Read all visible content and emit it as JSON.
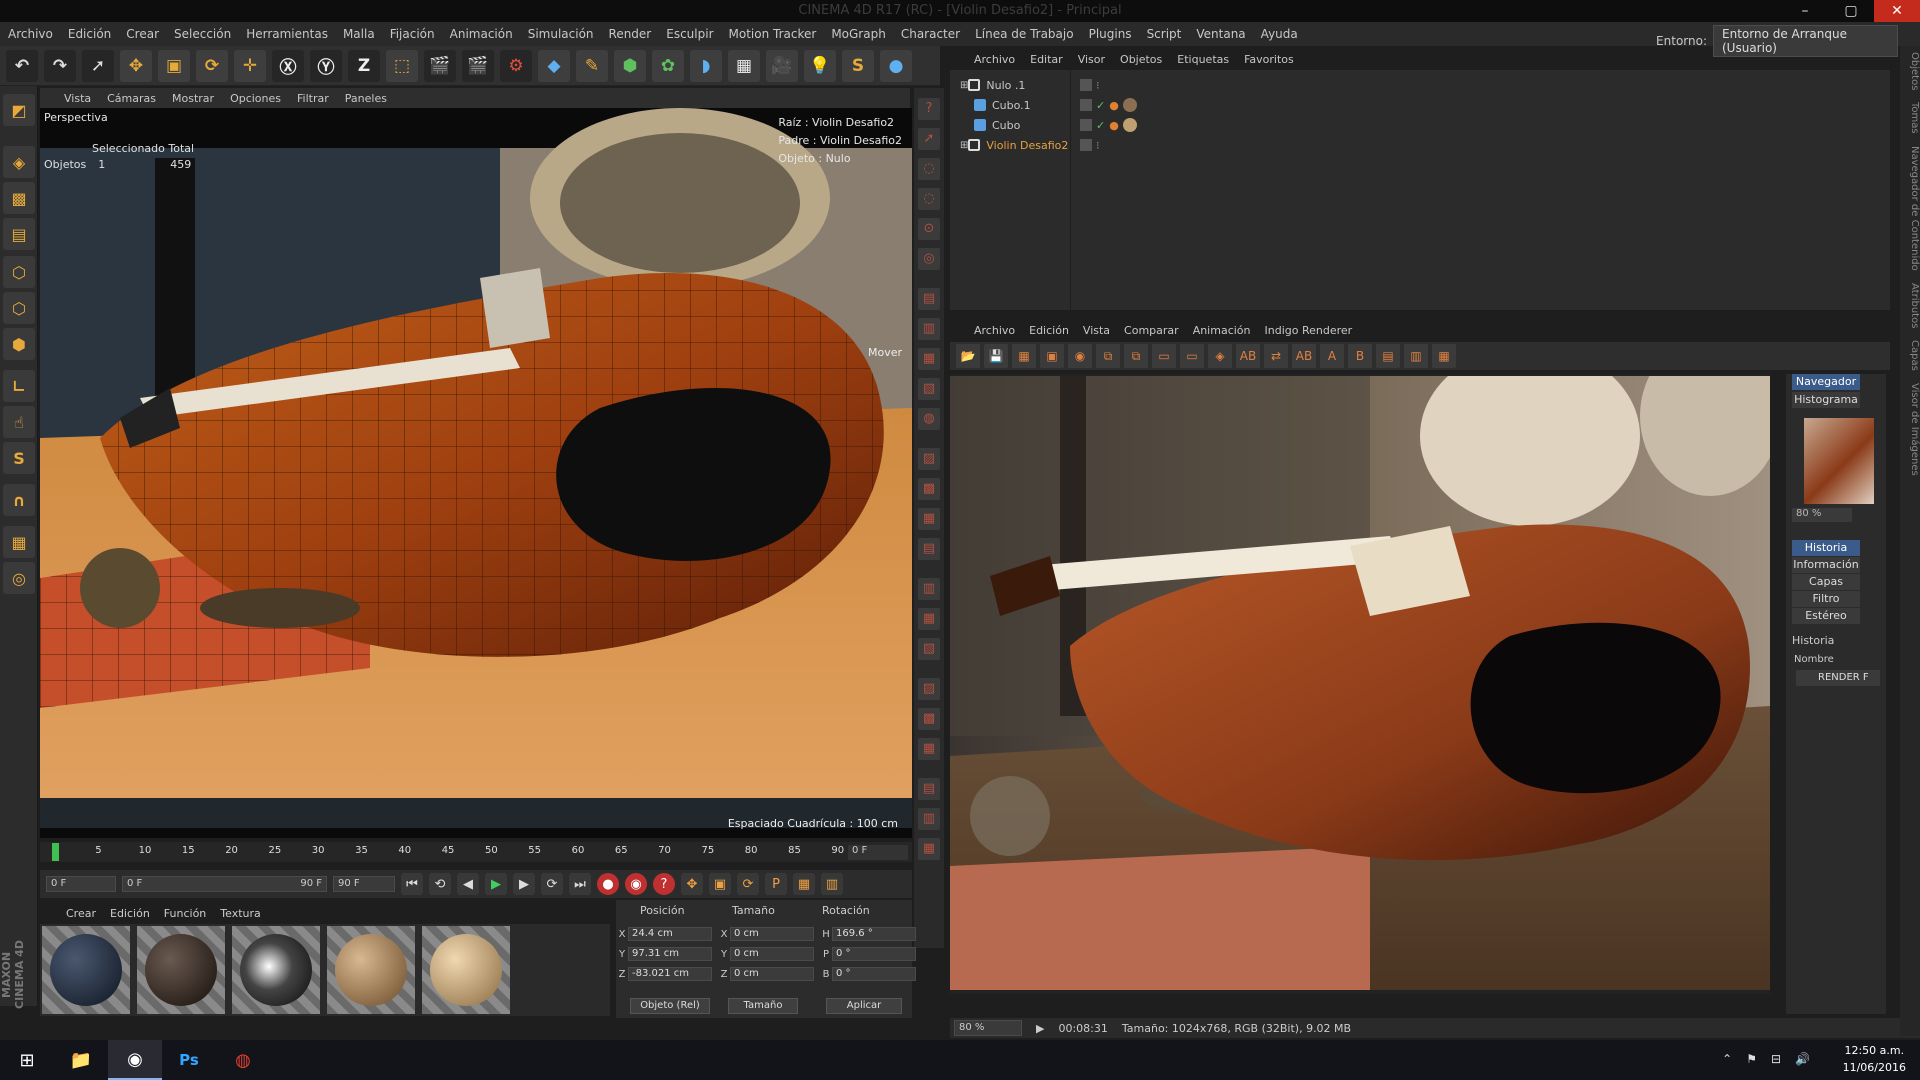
{
  "window": {
    "title": "CINEMA 4D R17 (RC) - [Violin Desafio2] - Principal"
  },
  "menu": [
    "Archivo",
    "Edición",
    "Crear",
    "Selección",
    "Herramientas",
    "Malla",
    "Fijación",
    "Animación",
    "Simulación",
    "Render",
    "Esculpir",
    "Motion Tracker",
    "MoGraph",
    "Character",
    "Línea de Trabajo",
    "Plugins",
    "Script",
    "Ventana",
    "Ayuda"
  ],
  "environment": {
    "label": "Entorno:",
    "value": "Entorno de Arranque (Usuario)"
  },
  "viewport": {
    "menu": [
      "Vista",
      "Cámaras",
      "Mostrar",
      "Opciones",
      "Filtrar",
      "Paneles"
    ],
    "title": "Perspectiva",
    "selection_header": "Seleccionado Total",
    "objects_label": "Objetos",
    "objects_selected": "1",
    "objects_total": "459",
    "root": "Raíz : Violin Desafio2",
    "parent": "Padre : Violin Desafio2",
    "object": "Objeto : Nulo",
    "mode": "Mover",
    "grid_spacing": "Espaciado Cuadrícula : 100 cm"
  },
  "timeline": {
    "ticks": [
      "0",
      "5",
      "10",
      "15",
      "20",
      "25",
      "30",
      "35",
      "40",
      "45",
      "50",
      "55",
      "60",
      "65",
      "70",
      "75",
      "80",
      "85",
      "90"
    ],
    "current": "0 F",
    "start": "0 F",
    "range_start": "0 F",
    "range_end": "90 F",
    "end": "90 F"
  },
  "materials": {
    "menu": [
      "Crear",
      "Edición",
      "Función",
      "Textura"
    ]
  },
  "coordinates": {
    "headers": [
      "Posición",
      "Tamaño",
      "Rotación"
    ],
    "rows": [
      {
        "pa": "X",
        "pv": "24.4 cm",
        "sa": "X",
        "sv": "0 cm",
        "ra": "H",
        "rv": "169.6 °"
      },
      {
        "pa": "Y",
        "pv": "97.31 cm",
        "sa": "Y",
        "sv": "0 cm",
        "ra": "P",
        "rv": "0 °"
      },
      {
        "pa": "Z",
        "pv": "-83.021 cm",
        "sa": "Z",
        "sv": "0 cm",
        "ra": "B",
        "rv": "0 °"
      }
    ],
    "mode": "Objeto (Rel)",
    "size_mode": "Tamaño",
    "apply": "Aplicar"
  },
  "objects": {
    "menu": [
      "Archivo",
      "Editar",
      "Visor",
      "Objetos",
      "Etiquetas",
      "Favoritos"
    ],
    "items": [
      {
        "name": "Nulo .1",
        "color": "#c8c8c8"
      },
      {
        "name": "Cubo.1",
        "color": "#c8c8c8"
      },
      {
        "name": "Cubo",
        "color": "#c8c8c8"
      },
      {
        "name": "Violin Desafio2",
        "color": "#e6a040"
      }
    ]
  },
  "picture_viewer": {
    "menu": [
      "Archivo",
      "Edición",
      "Vista",
      "Comparar",
      "Animación",
      "Indigo Renderer"
    ],
    "nav_tabs": [
      "Navegador",
      "Histograma"
    ],
    "zoom": "80 %",
    "info_tabs": [
      "Historia",
      "Información",
      "Capas",
      "Filtro",
      "Estéreo"
    ],
    "history_title": "Historia",
    "history_col": "Nombre",
    "history_item": "RENDER F",
    "status_zoom": "80 %",
    "status_time": "00:08:31",
    "status_size": "Tamaño: 1024x768, RGB (32Bit), 9.02 MB"
  },
  "side_tabs": [
    "Objetos",
    "Tomas",
    "Navegador de Contenido",
    "Atributos",
    "Capas",
    "Visor de Imágenes"
  ],
  "clock": {
    "time": "12:50 a.m.",
    "date": "11/06/2016"
  }
}
